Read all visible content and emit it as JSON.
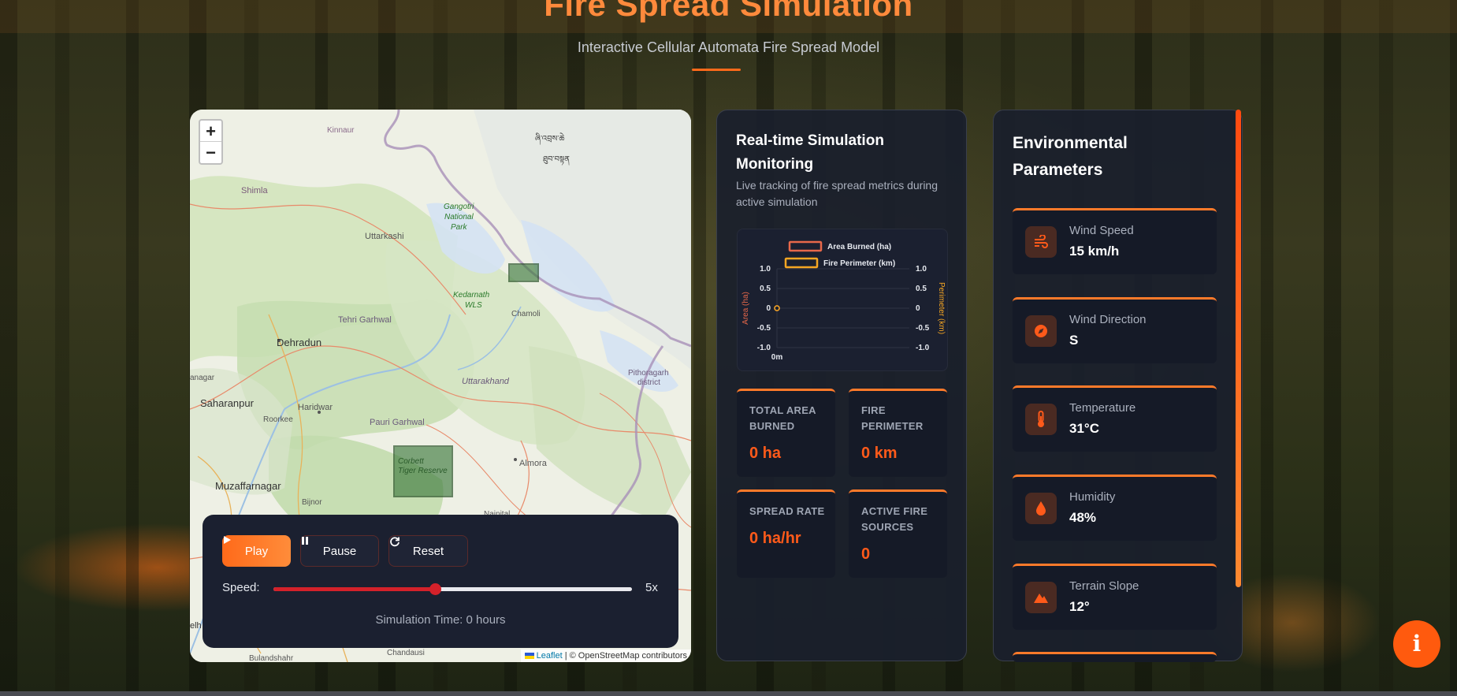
{
  "header": {
    "title": "Fire Spread Simulation",
    "subtitle": "Interactive Cellular Automata Fire Spread Model"
  },
  "map": {
    "zoom_in": "+",
    "zoom_out": "−",
    "labels": {
      "kinnaur": "Kinnaur",
      "tibetan1": "ཞི་འབྲས་ཆེ",
      "tibetan2": "ཐུབ་བསྟན",
      "shimla": "Shimla",
      "gangotri1": "Gangotri",
      "gangotri2": "National",
      "gangotri3": "Park",
      "uttarkashi": "Uttarkashi",
      "kedarnath1": "Kedarnath",
      "kedarnath2": "WLS",
      "chamoli": "Chamoli",
      "tehri": "Tehri Garhwal",
      "dehradun": "Dehradun",
      "uttarakhand": "Uttarakhand",
      "pithoragarh1": "Pithoragarh",
      "pithoragarh2": "district",
      "anagar": "anagar",
      "saharanpur": "Saharanpur",
      "haridwar": "Haridwar",
      "roorkee": "Roorkee",
      "pauri": "Pauri Garhwal",
      "corbett1": "Corbett",
      "corbett2": "Tiger Reserve",
      "almora": "Almora",
      "muzaffarnagar": "Muzaffarnagar",
      "bijnor": "Bijnor",
      "nainital": "Nainital",
      "chandausi": "Chandausi",
      "bulandshahr": "Bulandshahr",
      "elh": "elh"
    },
    "attribution_link": "Leaflet",
    "attribution_text": " | © OpenStreetMap contributors"
  },
  "controls": {
    "play_label": "Play",
    "pause_label": "Pause",
    "reset_label": "Reset",
    "speed_label": "Speed:",
    "speed_value": "5x",
    "speed_fraction": 0.45,
    "sim_time": "Simulation Time: 0 hours"
  },
  "monitor": {
    "title_line1": "Real-time Simulation",
    "title_line2": "Monitoring",
    "description": "Live tracking of fire spread metrics during active simulation",
    "stats": [
      {
        "label": "TOTAL AREA BURNED",
        "value": "0 ha"
      },
      {
        "label": "FIRE PERIMETER",
        "value": "0 km"
      },
      {
        "label": "SPREAD RATE",
        "value": "0 ha/hr"
      },
      {
        "label": "ACTIVE FIRE SOURCES",
        "value": "0"
      }
    ]
  },
  "chart_data": {
    "type": "line",
    "x": [
      "0m"
    ],
    "series": [
      {
        "name": "Area Burned (ha)",
        "values": [
          0
        ],
        "color": "#e8684a",
        "axis": "left"
      },
      {
        "name": "Fire Perimeter (km)",
        "values": [
          0
        ],
        "color": "#f5a623",
        "axis": "right"
      }
    ],
    "ylabel": "Area (ha)",
    "y2label": "Perimeter (km)",
    "ylim": [
      -1.0,
      1.0
    ],
    "y2lim": [
      -1.0,
      1.0
    ],
    "yticks": [
      "1.0",
      "0.5",
      "0",
      "-0.5",
      "-1.0"
    ],
    "legend_position": "top",
    "grid": true
  },
  "environment": {
    "title_line1": "Environmental",
    "title_line2": "Parameters",
    "params": [
      {
        "label": "Wind Speed",
        "value": "15 km/h",
        "icon": "wind-icon"
      },
      {
        "label": "Wind Direction",
        "value": "S",
        "icon": "compass-icon"
      },
      {
        "label": "Temperature",
        "value": "31°C",
        "icon": "thermometer-icon"
      },
      {
        "label": "Humidity",
        "value": "48%",
        "icon": "droplet-icon"
      },
      {
        "label": "Terrain Slope",
        "value": "12°",
        "icon": "mountain-icon"
      }
    ]
  },
  "info_button": "i",
  "colors": {
    "accent": "#ff6a1a",
    "stat_value": "#ff5a1a",
    "panel_bg": "#1a1f2c"
  }
}
